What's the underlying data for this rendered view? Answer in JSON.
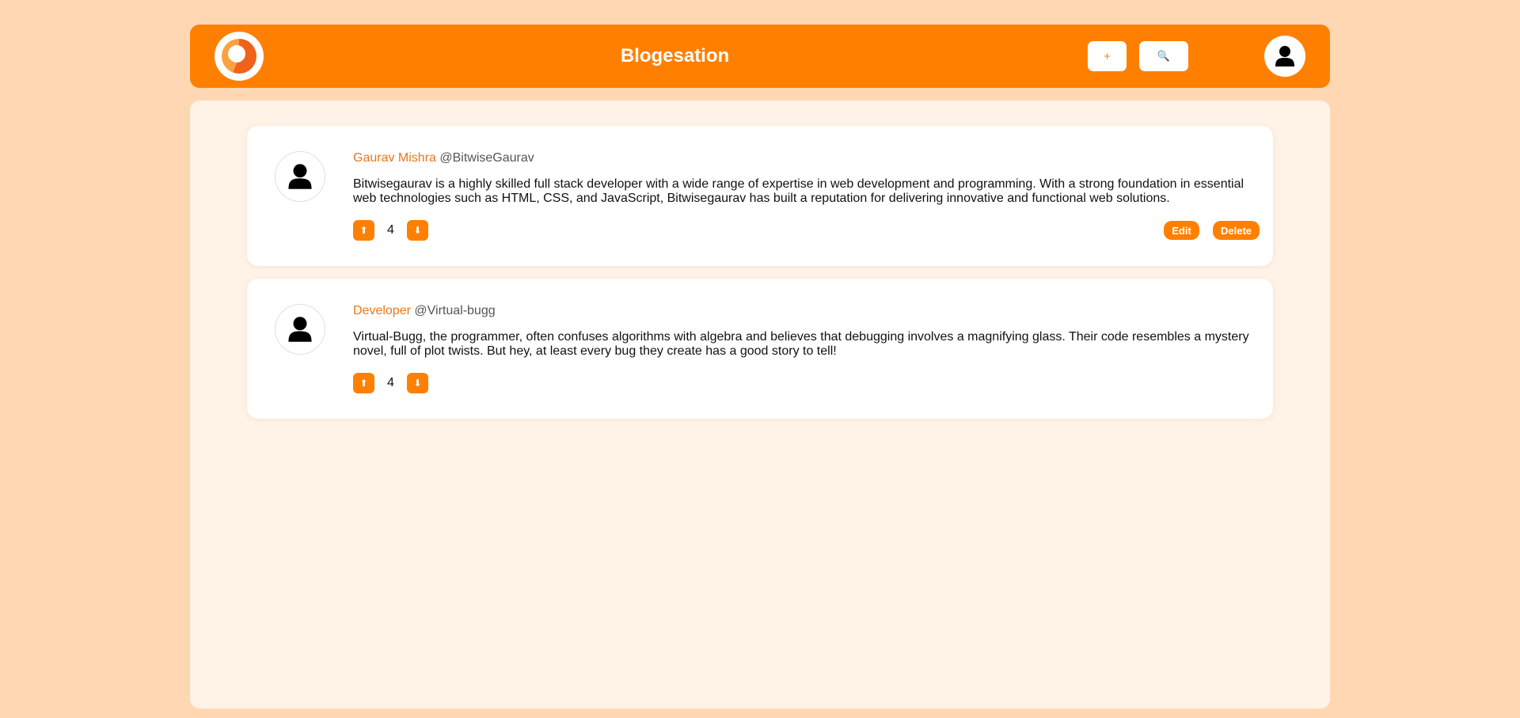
{
  "header": {
    "title": "Blogesation",
    "add_label": "+",
    "search_icon": "🔍",
    "profile_icon": "user-icon"
  },
  "colors": {
    "accent": "#ff8000",
    "page_bg": "#ffd8b3",
    "panel_bg": "#fff2e6",
    "author": "#e8781a"
  },
  "posts": [
    {
      "author": "Gaurav Mishra",
      "handle": "@BitwiseGaurav",
      "body": "Bitwisegaurav is a highly skilled full stack developer with a wide range of expertise in web development and programming. With a strong foundation in essential web technologies such as HTML, CSS, and JavaScript, Bitwisegaurav has built a reputation for delivering innovative and functional web solutions.",
      "upvote_label": "⬆",
      "votes": "4",
      "downvote_label": "⬇",
      "edit_label": "Edit",
      "delete_label": "Delete"
    },
    {
      "author": "Developer",
      "handle": "@Virtual-bugg",
      "body": "Virtual-Bugg, the programmer, often confuses algorithms with algebra and believes that debugging involves a magnifying glass. Their code resembles a mystery novel, full of plot twists. But hey, at least every bug they create has a good story to tell!",
      "upvote_label": "⬆",
      "votes": "4",
      "downvote_label": "⬇"
    }
  ]
}
